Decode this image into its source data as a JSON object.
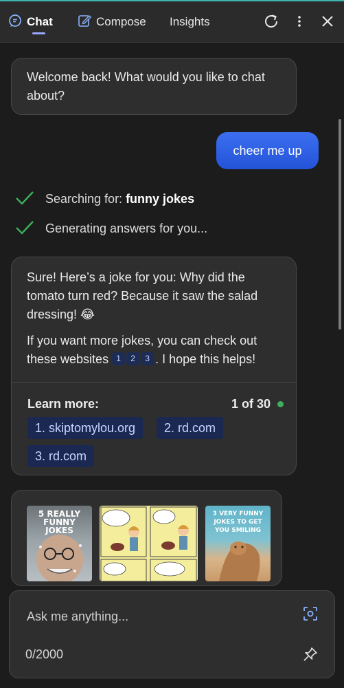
{
  "header": {
    "tabs": [
      {
        "label": "Chat",
        "active": true,
        "icon": "chat-icon"
      },
      {
        "label": "Compose",
        "active": false,
        "icon": "compose-icon"
      },
      {
        "label": "Insights",
        "active": false
      }
    ],
    "actions": [
      "refresh-icon",
      "more-icon",
      "close-icon"
    ],
    "accent_color": "#3fb5b1"
  },
  "conversation": {
    "welcome": "Welcome back! What would you like to chat about?",
    "user_message": "cheer me up",
    "status": {
      "searching_prefix": "Searching for: ",
      "searching_query": "funny jokes",
      "generating": "Generating answers for you..."
    },
    "answer": {
      "paragraph1": "Sure! Here’s a joke for you: Why did the tomato turn red? Because it saw the salad dressing! 😂",
      "paragraph2_before": "If you want more jokes, you can check out these websites",
      "refs": [
        "1",
        "2",
        "3"
      ],
      "paragraph2_after": ". I hope this helps!",
      "learn_more_label": "Learn more:",
      "page_count": "1 of 30",
      "links": [
        "1. skiptomylou.org",
        "2. rd.com",
        "3. rd.com"
      ]
    },
    "images": {
      "thumb1_caption": "5 REALLY FUNNY JOKES",
      "thumb3_caption": "3 VERY FUNNY JOKES TO GET YOU SMILING"
    }
  },
  "composer": {
    "placeholder": "Ask me anything...",
    "char_count": "0/2000",
    "icons": [
      "visual-search-icon",
      "pin-icon"
    ]
  },
  "colors": {
    "user_bubble": "#2f5fe8",
    "link_chip_bg": "#1a2852",
    "check_green": "#3fae5c"
  }
}
